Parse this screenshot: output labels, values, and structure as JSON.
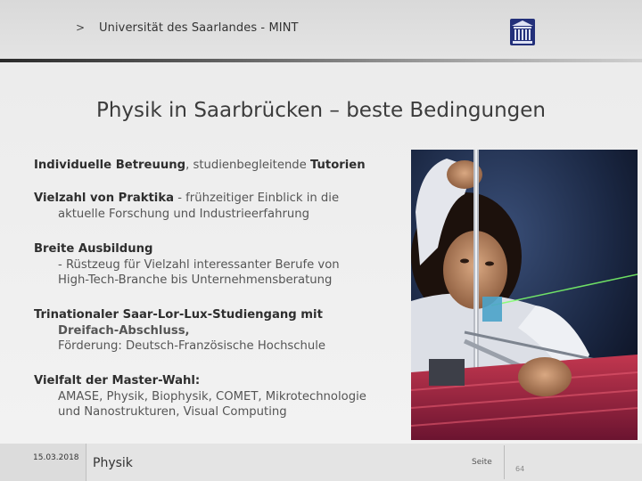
{
  "header": {
    "chevron": ">",
    "university": "Universität des Saarlandes - MINT",
    "logo_icon": "university-seal-icon"
  },
  "slide": {
    "title": "Physik in Saarbrücken – beste Bedingungen",
    "bullets": [
      {
        "bold": "Individuelle Betreuung",
        "mid": ", studienbegleitende ",
        "bold2": "Tutorien"
      },
      {
        "bold": "Vielzahl von Praktika",
        "rest": " - frühzeitiger Einblick in die",
        "sub": "aktuelle Forschung und Industrieerfahrung"
      },
      {
        "bold": "Breite Ausbildung",
        "sub1": "- Rüstzeug für Vielzahl interessanter Berufe von",
        "sub2": "High-Tech-Branche bis Unternehmensberatung"
      },
      {
        "bold": "Trinationaler Saar-Lor-Lux-Studiengang mit",
        "bold_sub": "Dreifach-Abschluss,",
        "sub": "Förderung: Deutsch-Französische Hochschule"
      },
      {
        "bold": "Vielfalt der Master-Wahl:",
        "sub1": "AMASE, Physik, Biophysik, COMET, Mikrotechnologie",
        "sub2": "und Nanostrukturen, Visual Computing"
      }
    ],
    "photo_subject": "student-with-laser-experiment"
  },
  "footer": {
    "date": "15.03.2018",
    "subject": "Physik",
    "seite_label": "Seite",
    "page_number": "64"
  }
}
